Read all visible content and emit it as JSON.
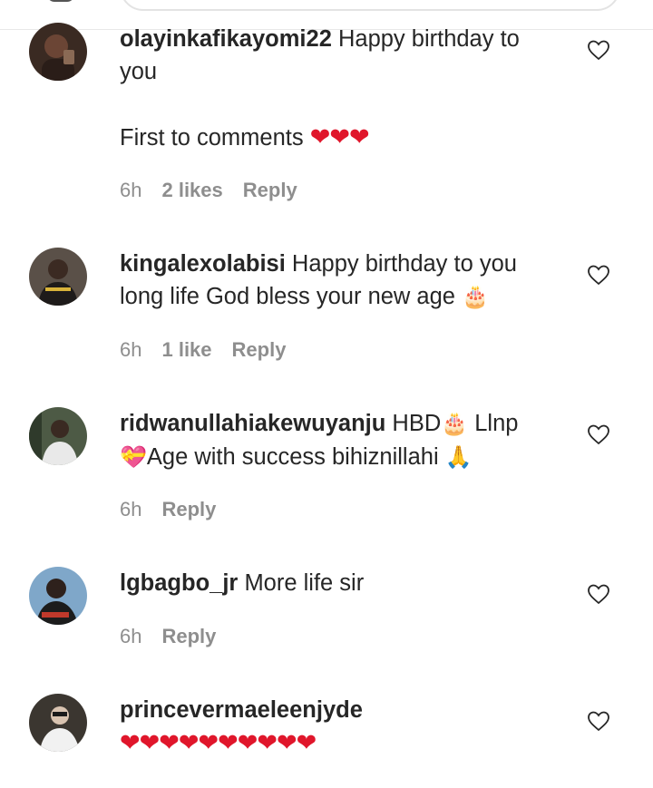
{
  "colors": {
    "heart_emoji": "#e0162b",
    "meta_text": "#8e8e8e",
    "text": "#262626"
  },
  "comments": [
    {
      "username": "olayinkafikayomi22",
      "text_line1": "Happy birthday to",
      "text_line2": "you",
      "text_line3": "First to comments",
      "emoji": "❤❤❤",
      "time": "6h",
      "likes": "2 likes",
      "reply": "Reply"
    },
    {
      "username": "kingalexolabisi",
      "text_line1": "Happy birthday to you",
      "text_line2": "long life God bless your new age",
      "emoji": "🎂",
      "time": "6h",
      "likes": "1 like",
      "reply": "Reply"
    },
    {
      "username": "ridwanullahiakewuyanju",
      "text_line1": "HBD",
      "emoji1": "🎂",
      "text_line1b": "Llnp",
      "emoji2": "💝",
      "text_line2": "Age with success bihiznillahi",
      "emoji3": "🙏",
      "time": "6h",
      "reply": "Reply"
    },
    {
      "username": "lgbagbo_jr",
      "text_line1": "More life sir",
      "time": "6h",
      "reply": "Reply"
    },
    {
      "username": "princevermaeleenjyde",
      "emoji": "❤❤❤❤❤❤❤❤❤❤"
    }
  ]
}
